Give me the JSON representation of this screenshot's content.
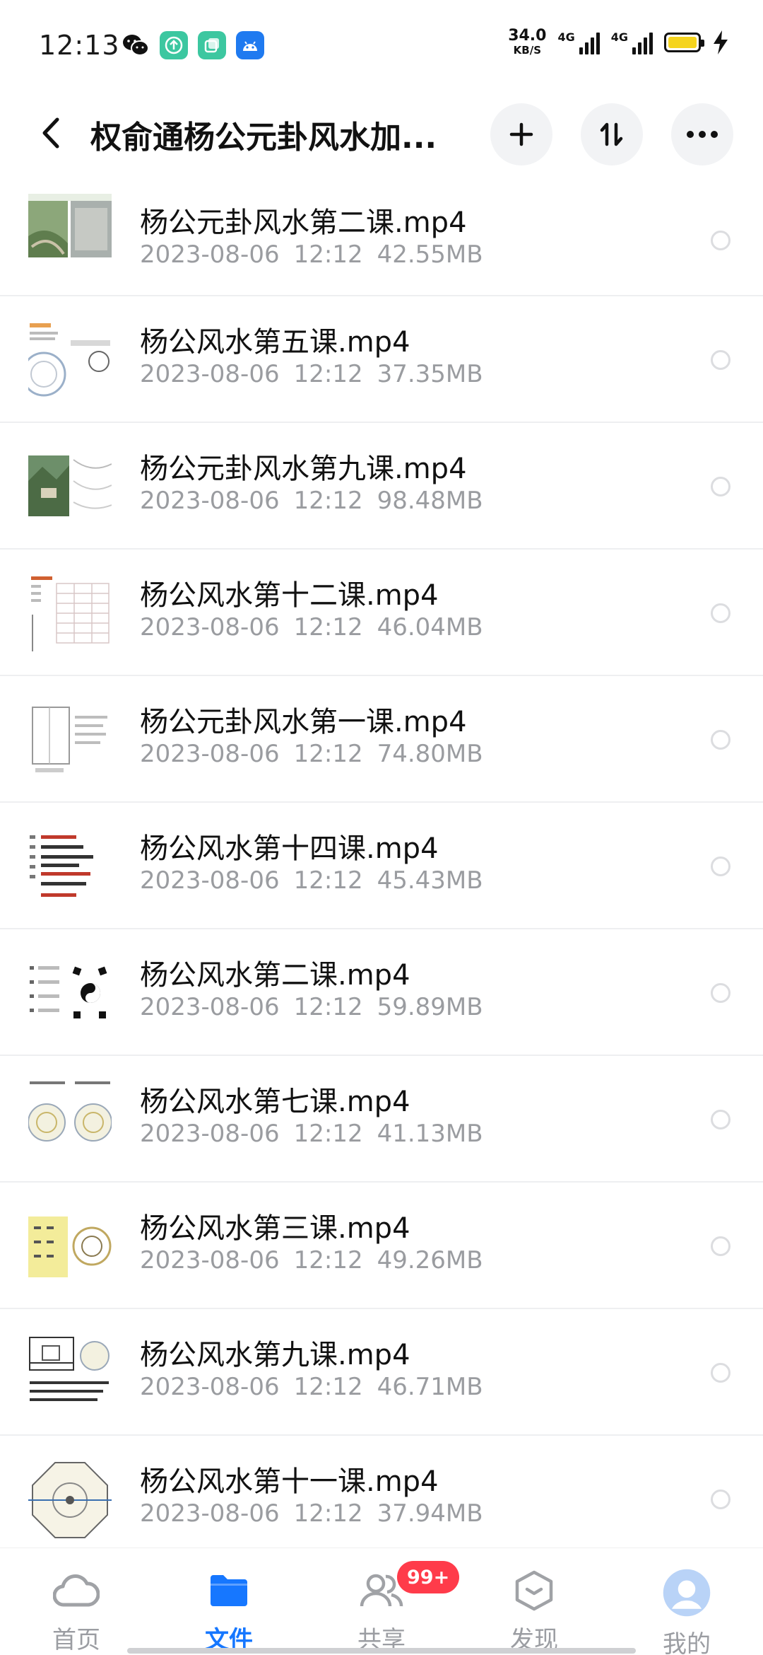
{
  "status_bar": {
    "time": "12:13",
    "net_speed": "34.0",
    "net_speed_unit": "KB/S",
    "signal1_label": "4G",
    "signal2_label": "4G",
    "apps": [
      "wechat-icon",
      "upload-icon",
      "gallery-icon",
      "android-icon"
    ]
  },
  "header": {
    "title": "权俞通杨公元卦风水加...",
    "back_icon": "back-arrow-icon",
    "add_icon": "plus-icon",
    "sort_icon": "sort-icon",
    "more_icon": "more-icon"
  },
  "files": [
    {
      "name": "杨公元卦风水第二课.mp4",
      "date": "2023-08-06",
      "time": "12:12",
      "size": "42.55MB"
    },
    {
      "name": "杨公风水第五课.mp4",
      "date": "2023-08-06",
      "time": "12:12",
      "size": "37.35MB"
    },
    {
      "name": "杨公元卦风水第九课.mp4",
      "date": "2023-08-06",
      "time": "12:12",
      "size": "98.48MB"
    },
    {
      "name": "杨公风水第十二课.mp4",
      "date": "2023-08-06",
      "time": "12:12",
      "size": "46.04MB"
    },
    {
      "name": "杨公元卦风水第一课.mp4",
      "date": "2023-08-06",
      "time": "12:12",
      "size": "74.80MB"
    },
    {
      "name": "杨公风水第十四课.mp4",
      "date": "2023-08-06",
      "time": "12:12",
      "size": "45.43MB"
    },
    {
      "name": "杨公风水第二课.mp4",
      "date": "2023-08-06",
      "time": "12:12",
      "size": "59.89MB"
    },
    {
      "name": "杨公风水第七课.mp4",
      "date": "2023-08-06",
      "time": "12:12",
      "size": "41.13MB"
    },
    {
      "name": "杨公风水第三课.mp4",
      "date": "2023-08-06",
      "time": "12:12",
      "size": "49.26MB"
    },
    {
      "name": "杨公风水第九课.mp4",
      "date": "2023-08-06",
      "time": "12:12",
      "size": "46.71MB"
    },
    {
      "name": "杨公风水第十一课.mp4",
      "date": "2023-08-06",
      "time": "12:12",
      "size": "37.94MB"
    }
  ],
  "bottom_nav": {
    "items": [
      {
        "label": "首页",
        "icon": "cloud-icon",
        "active": false
      },
      {
        "label": "文件",
        "icon": "folder-icon",
        "active": true
      },
      {
        "label": "共享",
        "icon": "share-people-icon",
        "active": false,
        "badge": "99+"
      },
      {
        "label": "发现",
        "icon": "discover-icon",
        "active": false
      },
      {
        "label": "我的",
        "icon": "profile-avatar-icon",
        "active": false
      }
    ]
  },
  "colors": {
    "accent": "#1677ff",
    "badge": "#ff3b4a",
    "text_primary": "#111111",
    "text_secondary": "#9a9ca0",
    "battery": "#f5d41e"
  }
}
